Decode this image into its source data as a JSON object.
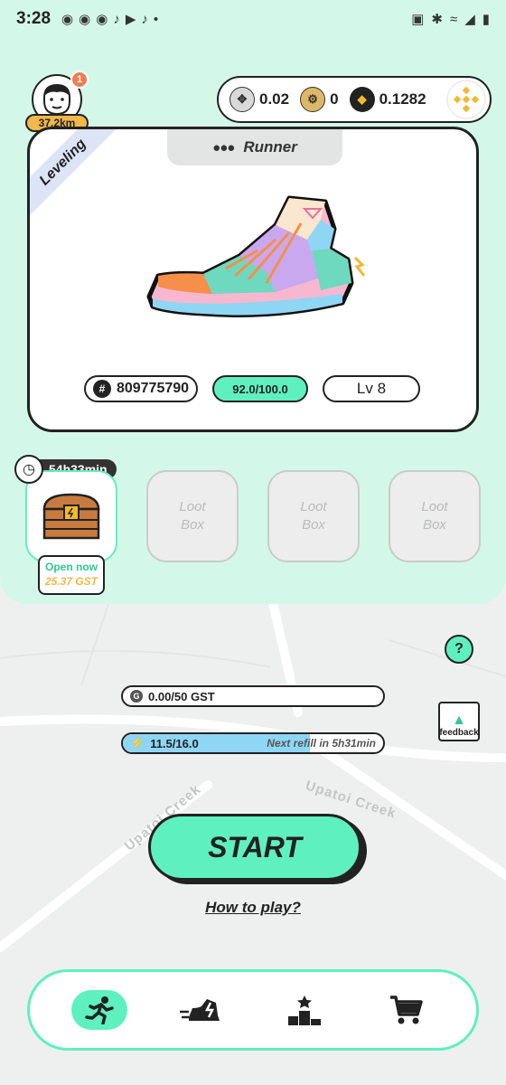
{
  "status_bar": {
    "time": "3:28",
    "app_icons": [
      "discord-icon",
      "discord-icon",
      "discord-icon",
      "tiktok-icon",
      "youtube-icon",
      "tiktok-icon",
      "dot-icon"
    ],
    "right_icons": [
      "nfc-icon",
      "bluetooth-icon",
      "wifi-icon",
      "signal-icon",
      "battery-icon"
    ]
  },
  "profile": {
    "notification_count": "1",
    "distance": "37.2km"
  },
  "balances": [
    {
      "token": "gst",
      "icon": "gst-coin-icon",
      "value": "0.02"
    },
    {
      "token": "gmt",
      "icon": "gmt-coin-icon",
      "value": "0"
    },
    {
      "token": "bnb",
      "icon": "bnb-coin-icon",
      "value": "0.1282"
    }
  ],
  "sneaker_card": {
    "ribbon": "Leveling",
    "type": "Runner",
    "id": "809775790",
    "durability": "92.0/100.0",
    "level": "Lv 8",
    "colors": {
      "accent": "#5ff0c0",
      "pink": "#f7b8cf",
      "purple": "#c9a8f0",
      "blue": "#8fd6f5",
      "teal": "#6fd9c0",
      "orange": "#f58f4a"
    }
  },
  "loot": {
    "timer": "54h33min",
    "open_now_label": "Open now",
    "open_now_price": "25.37 GST",
    "empty_boxes": [
      {
        "label_line1": "Loot",
        "label_line2": "Box"
      },
      {
        "label_line1": "Loot",
        "label_line2": "Box"
      },
      {
        "label_line1": "Loot",
        "label_line2": "Box"
      }
    ]
  },
  "map": {
    "labels": [
      "Upatoi Creek",
      "Upatoi Creek"
    ]
  },
  "help_label": "?",
  "feedback_label": "feedback",
  "gst_cap": {
    "text": "0.00/50 GST",
    "progress": 0.0
  },
  "energy": {
    "text": "11.5/16.0",
    "progress": 0.72,
    "refill_text": "Next refill in 5h31min"
  },
  "start_label": "START",
  "how_to_play": "How to play?",
  "bottom_nav": [
    {
      "name": "run",
      "icon": "runner-icon",
      "active": true
    },
    {
      "name": "sneakers",
      "icon": "sneaker-icon",
      "active": false
    },
    {
      "name": "leaderboard",
      "icon": "podium-icon",
      "active": false
    },
    {
      "name": "marketplace",
      "icon": "cart-icon",
      "active": false
    }
  ]
}
